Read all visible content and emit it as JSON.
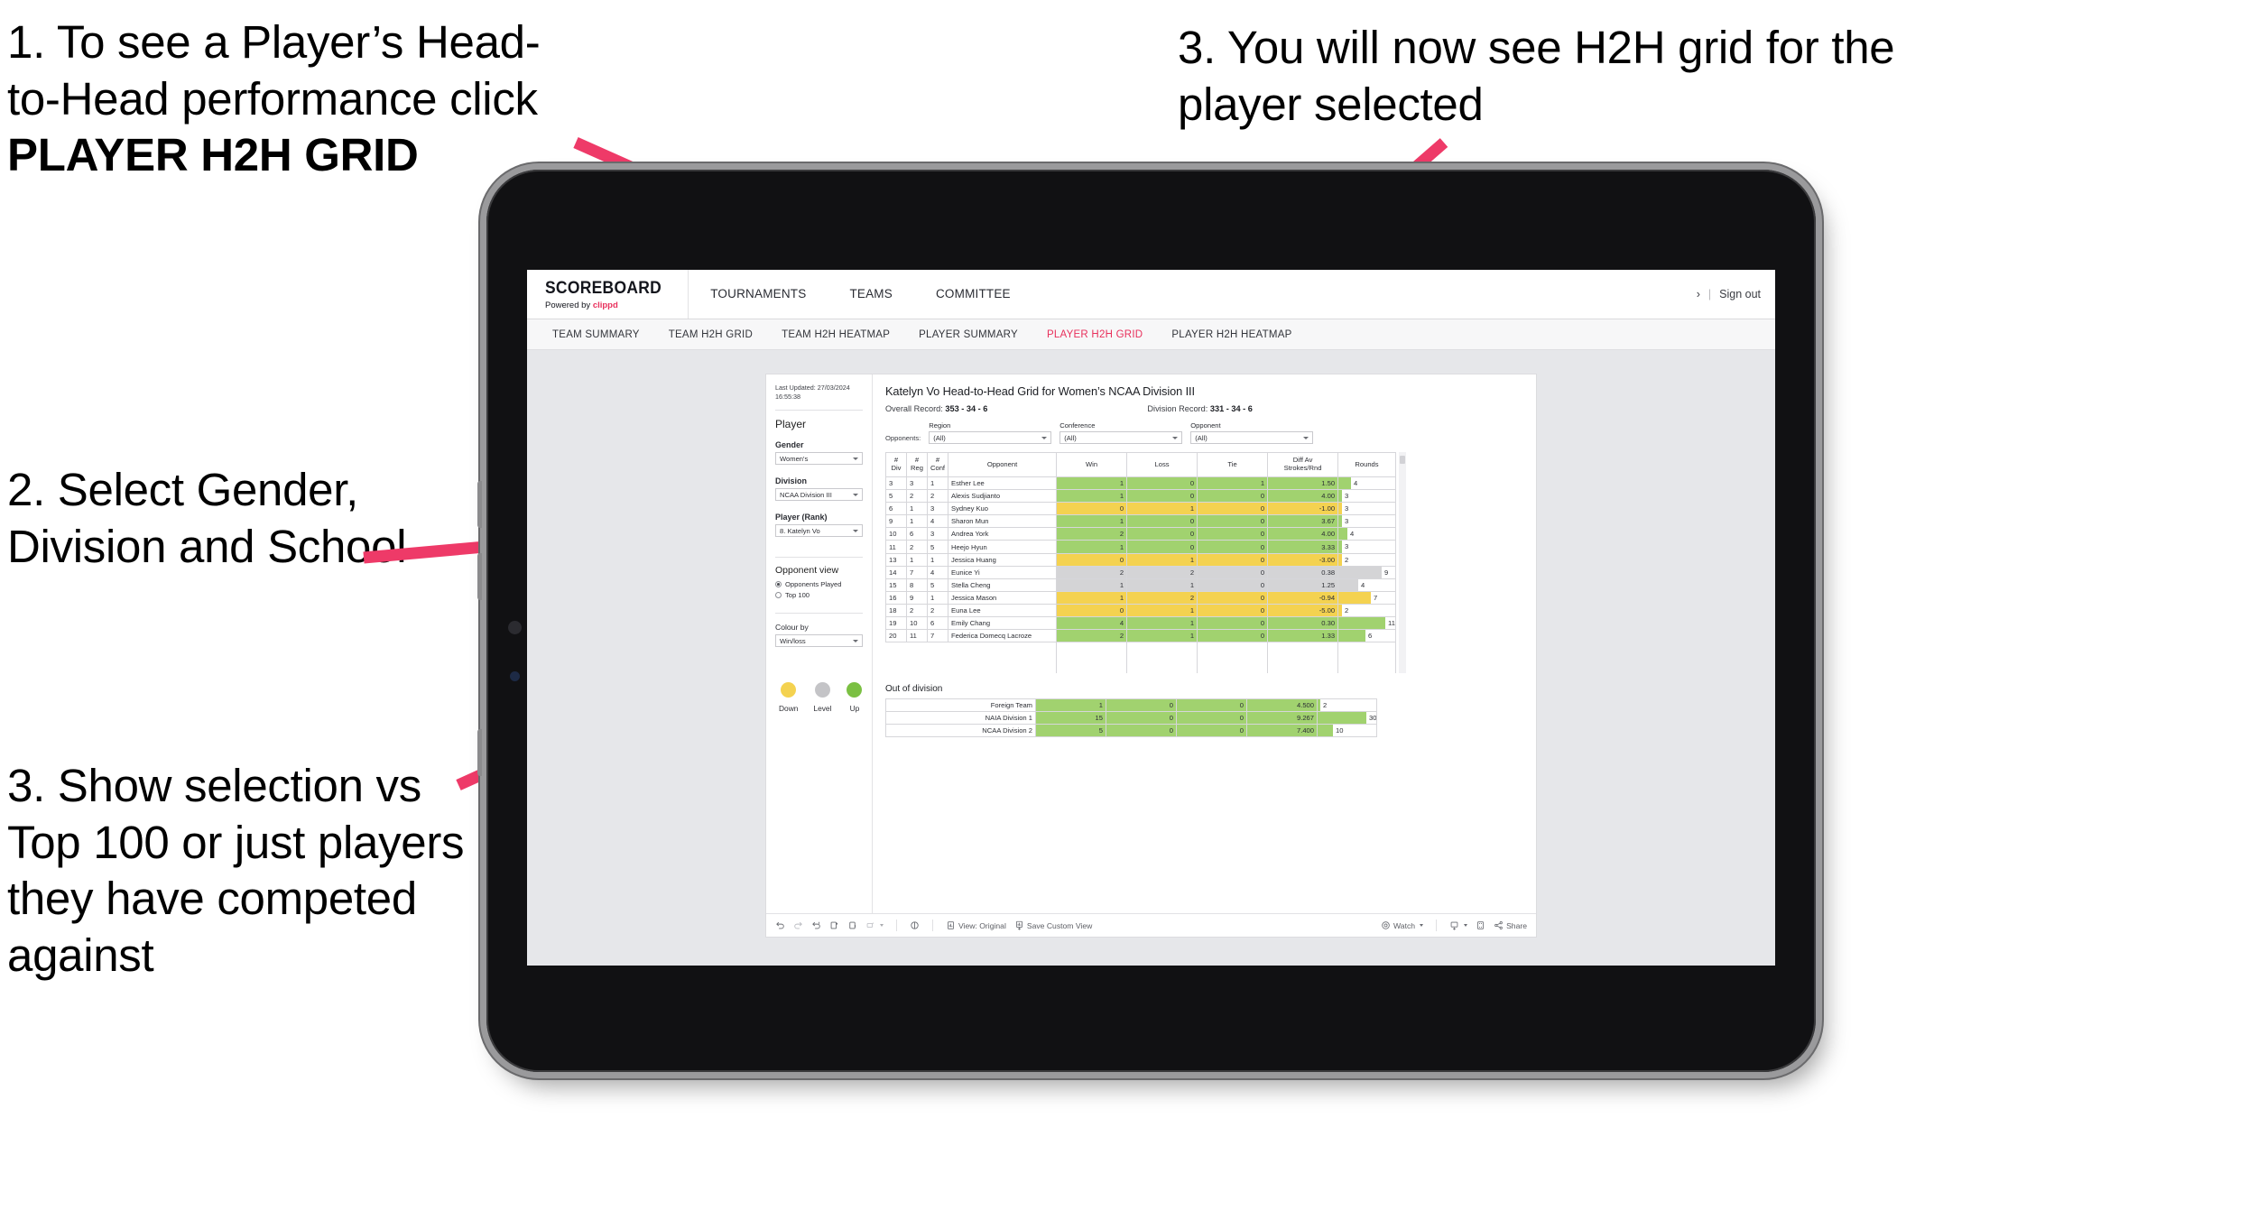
{
  "annotations": [
    {
      "id": "a1",
      "line1": "1. To see a Player’s Head-",
      "line2": "to-Head performance click",
      "line3": "PLAYER H2H GRID"
    },
    {
      "id": "a2",
      "text": "2. Select Gender, Division and School"
    },
    {
      "id": "a3",
      "text": "3. Show selection vs Top 100 or just players they have competed against"
    },
    {
      "id": "a4",
      "text": "3. You will now see H2H grid for the player selected"
    }
  ],
  "colors": {
    "accent_pink": "#e8305c",
    "arrow_pink": "#ee3a68",
    "green": "#a1d26f",
    "yellow": "#f4d250",
    "grey": "#d4d4d6"
  },
  "app": {
    "brand": {
      "title": "SCOREBOARD",
      "powered_prefix": "Powered by ",
      "powered_brand": "clippd"
    },
    "top_nav": [
      "TOURNAMENTS",
      "TEAMS",
      "COMMITTEE"
    ],
    "top_right": {
      "chevron": "›",
      "separator": "|",
      "sign_out": "Sign out"
    },
    "tabs": [
      {
        "label": "TEAM SUMMARY",
        "active": false
      },
      {
        "label": "TEAM H2H GRID",
        "active": false
      },
      {
        "label": "TEAM H2H HEATMAP",
        "active": false
      },
      {
        "label": "PLAYER SUMMARY",
        "active": false
      },
      {
        "label": "PLAYER H2H GRID",
        "active": true
      },
      {
        "label": "PLAYER H2H HEATMAP",
        "active": false
      }
    ]
  },
  "panel": {
    "last_updated": "Last Updated: 27/03/2024 16:55:38",
    "section_title": "Player",
    "fields": [
      {
        "label": "Gender",
        "value": "Women's"
      },
      {
        "label": "Division",
        "value": "NCAA Division III"
      },
      {
        "label": "Player (Rank)",
        "value": "8. Katelyn Vo"
      }
    ],
    "opponent_view": {
      "title": "Opponent view",
      "options": [
        {
          "label": "Opponents Played",
          "selected": true
        },
        {
          "label": "Top 100",
          "selected": false
        }
      ]
    },
    "colour_by": {
      "label": "Colour by",
      "value": "Win/loss"
    },
    "legend": [
      {
        "label": "Down",
        "color": "#f4d250"
      },
      {
        "label": "Level",
        "color": "#c4c4c7"
      },
      {
        "label": "Up",
        "color": "#7bc043"
      }
    ]
  },
  "viz": {
    "title": "Katelyn Vo Head-to-Head Grid for Women’s NCAA Division III",
    "overall_record_label": "Overall Record: ",
    "overall_record_value": "353 - 34 - 6",
    "division_record_label": "Division Record: ",
    "division_record_value": "331 - 34 - 6",
    "opponents_label": "Opponents:",
    "filters": [
      {
        "title": "Region",
        "value": "(All)"
      },
      {
        "title": "Conference",
        "value": "(All)"
      },
      {
        "title": "Opponent",
        "value": "(All)"
      }
    ],
    "columns": [
      {
        "l1": "#",
        "l2": "Div"
      },
      {
        "l1": "#",
        "l2": "Reg"
      },
      {
        "l1": "#",
        "l2": "Conf"
      },
      {
        "l1": "Opponent",
        "l2": ""
      },
      {
        "l1": "Win",
        "l2": ""
      },
      {
        "l1": "Loss",
        "l2": ""
      },
      {
        "l1": "Tie",
        "l2": ""
      },
      {
        "l1": "Diff Av",
        "l2": "Strokes/Rnd"
      },
      {
        "l1": "Rounds",
        "l2": ""
      }
    ],
    "rows": [
      {
        "div": "3",
        "reg": "3",
        "conf": "1",
        "opponent": "Esther Lee",
        "win": "1",
        "loss": "0",
        "tie": "1",
        "diff": "1.50",
        "rounds": "4",
        "color": "g",
        "bar": 14
      },
      {
        "div": "5",
        "reg": "2",
        "conf": "2",
        "opponent": "Alexis Sudjianto",
        "win": "1",
        "loss": "0",
        "tie": "0",
        "diff": "4.00",
        "rounds": "3",
        "color": "g",
        "bar": 4
      },
      {
        "div": "6",
        "reg": "1",
        "conf": "3",
        "opponent": "Sydney Kuo",
        "win": "0",
        "loss": "1",
        "tie": "0",
        "diff": "-1.00",
        "rounds": "3",
        "color": "y",
        "bar": 4
      },
      {
        "div": "9",
        "reg": "1",
        "conf": "4",
        "opponent": "Sharon Mun",
        "win": "1",
        "loss": "0",
        "tie": "0",
        "diff": "3.67",
        "rounds": "3",
        "color": "g",
        "bar": 4
      },
      {
        "div": "10",
        "reg": "6",
        "conf": "3",
        "opponent": "Andrea York",
        "win": "2",
        "loss": "0",
        "tie": "0",
        "diff": "4.00",
        "rounds": "4",
        "color": "g",
        "bar": 10
      },
      {
        "div": "11",
        "reg": "2",
        "conf": "5",
        "opponent": "Heejo Hyun",
        "win": "1",
        "loss": "0",
        "tie": "0",
        "diff": "3.33",
        "rounds": "3",
        "color": "g",
        "bar": 4
      },
      {
        "div": "13",
        "reg": "1",
        "conf": "1",
        "opponent": "Jessica Huang",
        "win": "0",
        "loss": "1",
        "tie": "0",
        "diff": "-3.00",
        "rounds": "2",
        "color": "y",
        "bar": 4
      },
      {
        "div": "14",
        "reg": "7",
        "conf": "4",
        "opponent": "Eunice Yi",
        "win": "2",
        "loss": "2",
        "tie": "0",
        "diff": "0.38",
        "rounds": "9",
        "color": "n",
        "bar": 48
      },
      {
        "div": "15",
        "reg": "8",
        "conf": "5",
        "opponent": "Stella Cheng",
        "win": "1",
        "loss": "1",
        "tie": "0",
        "diff": "1.25",
        "rounds": "4",
        "color": "n",
        "bar": 22
      },
      {
        "div": "16",
        "reg": "9",
        "conf": "1",
        "opponent": "Jessica Mason",
        "win": "1",
        "loss": "2",
        "tie": "0",
        "diff": "-0.94",
        "rounds": "7",
        "color": "y",
        "bar": 36
      },
      {
        "div": "18",
        "reg": "2",
        "conf": "2",
        "opponent": "Euna Lee",
        "win": "0",
        "loss": "1",
        "tie": "0",
        "diff": "-5.00",
        "rounds": "2",
        "color": "y",
        "bar": 4
      },
      {
        "div": "19",
        "reg": "10",
        "conf": "6",
        "opponent": "Emily Chang",
        "win": "4",
        "loss": "1",
        "tie": "0",
        "diff": "0.30",
        "rounds": "11",
        "color": "g",
        "bar": 52
      },
      {
        "div": "20",
        "reg": "11",
        "conf": "7",
        "opponent": "Federica Domecq Lacroze",
        "win": "2",
        "loss": "1",
        "tie": "0",
        "diff": "1.33",
        "rounds": "6",
        "color": "g",
        "bar": 30
      }
    ],
    "out_of_division": {
      "title": "Out of division",
      "rows": [
        {
          "label": "Foreign Team",
          "win": "1",
          "loss": "0",
          "tie": "0",
          "diff": "4.500",
          "rounds": "2",
          "color": "g",
          "bar": 3
        },
        {
          "label": "NAIA Division 1",
          "win": "15",
          "loss": "0",
          "tie": "0",
          "diff": "9.267",
          "rounds": "30",
          "color": "g",
          "bar": 54
        },
        {
          "label": "NCAA Division 2",
          "win": "5",
          "loss": "0",
          "tie": "0",
          "diff": "7.400",
          "rounds": "10",
          "color": "g",
          "bar": 17
        }
      ]
    },
    "toolbar": {
      "view_original": "View: Original",
      "save_custom_view": "Save Custom View",
      "watch": "Watch",
      "share": "Share"
    }
  },
  "chart_data": {
    "type": "table",
    "title": "Katelyn Vo Head-to-Head Grid for Women’s NCAA Division III",
    "columns": [
      "# Div",
      "# Reg",
      "# Conf",
      "Opponent",
      "Win",
      "Loss",
      "Tie",
      "Diff Av Strokes/Rnd",
      "Rounds"
    ],
    "values": [
      [
        "3",
        "3",
        "1",
        "Esther Lee",
        1,
        0,
        1,
        1.5,
        4
      ],
      [
        "5",
        "2",
        "2",
        "Alexis Sudjianto",
        1,
        0,
        0,
        4.0,
        3
      ],
      [
        "6",
        "1",
        "3",
        "Sydney Kuo",
        0,
        1,
        0,
        -1.0,
        3
      ],
      [
        "9",
        "1",
        "4",
        "Sharon Mun",
        1,
        0,
        0,
        3.67,
        3
      ],
      [
        "10",
        "6",
        "3",
        "Andrea York",
        2,
        0,
        0,
        4.0,
        4
      ],
      [
        "11",
        "2",
        "5",
        "Heejo Hyun",
        1,
        0,
        0,
        3.33,
        3
      ],
      [
        "13",
        "1",
        "1",
        "Jessica Huang",
        0,
        1,
        0,
        -3.0,
        2
      ],
      [
        "14",
        "7",
        "4",
        "Eunice Yi",
        2,
        2,
        0,
        0.38,
        9
      ],
      [
        "15",
        "8",
        "5",
        "Stella Cheng",
        1,
        1,
        0,
        1.25,
        4
      ],
      [
        "16",
        "9",
        "1",
        "Jessica Mason",
        1,
        2,
        0,
        -0.94,
        7
      ],
      [
        "18",
        "2",
        "2",
        "Euna Lee",
        0,
        1,
        0,
        -5.0,
        2
      ],
      [
        "19",
        "10",
        "6",
        "Emily Chang",
        4,
        1,
        0,
        0.3,
        11
      ],
      [
        "20",
        "11",
        "7",
        "Federica Domecq Lacroze",
        2,
        1,
        0,
        1.33,
        6
      ]
    ],
    "out_of_division": [
      [
        "Foreign Team",
        1,
        0,
        0,
        4.5,
        2
      ],
      [
        "NAIA Division 1",
        15,
        0,
        0,
        9.267,
        30
      ],
      [
        "NCAA Division 2",
        5,
        0,
        0,
        7.4,
        10
      ]
    ],
    "legend": [
      "Down",
      "Level",
      "Up"
    ],
    "legend_position": "sidebar-bottom"
  }
}
